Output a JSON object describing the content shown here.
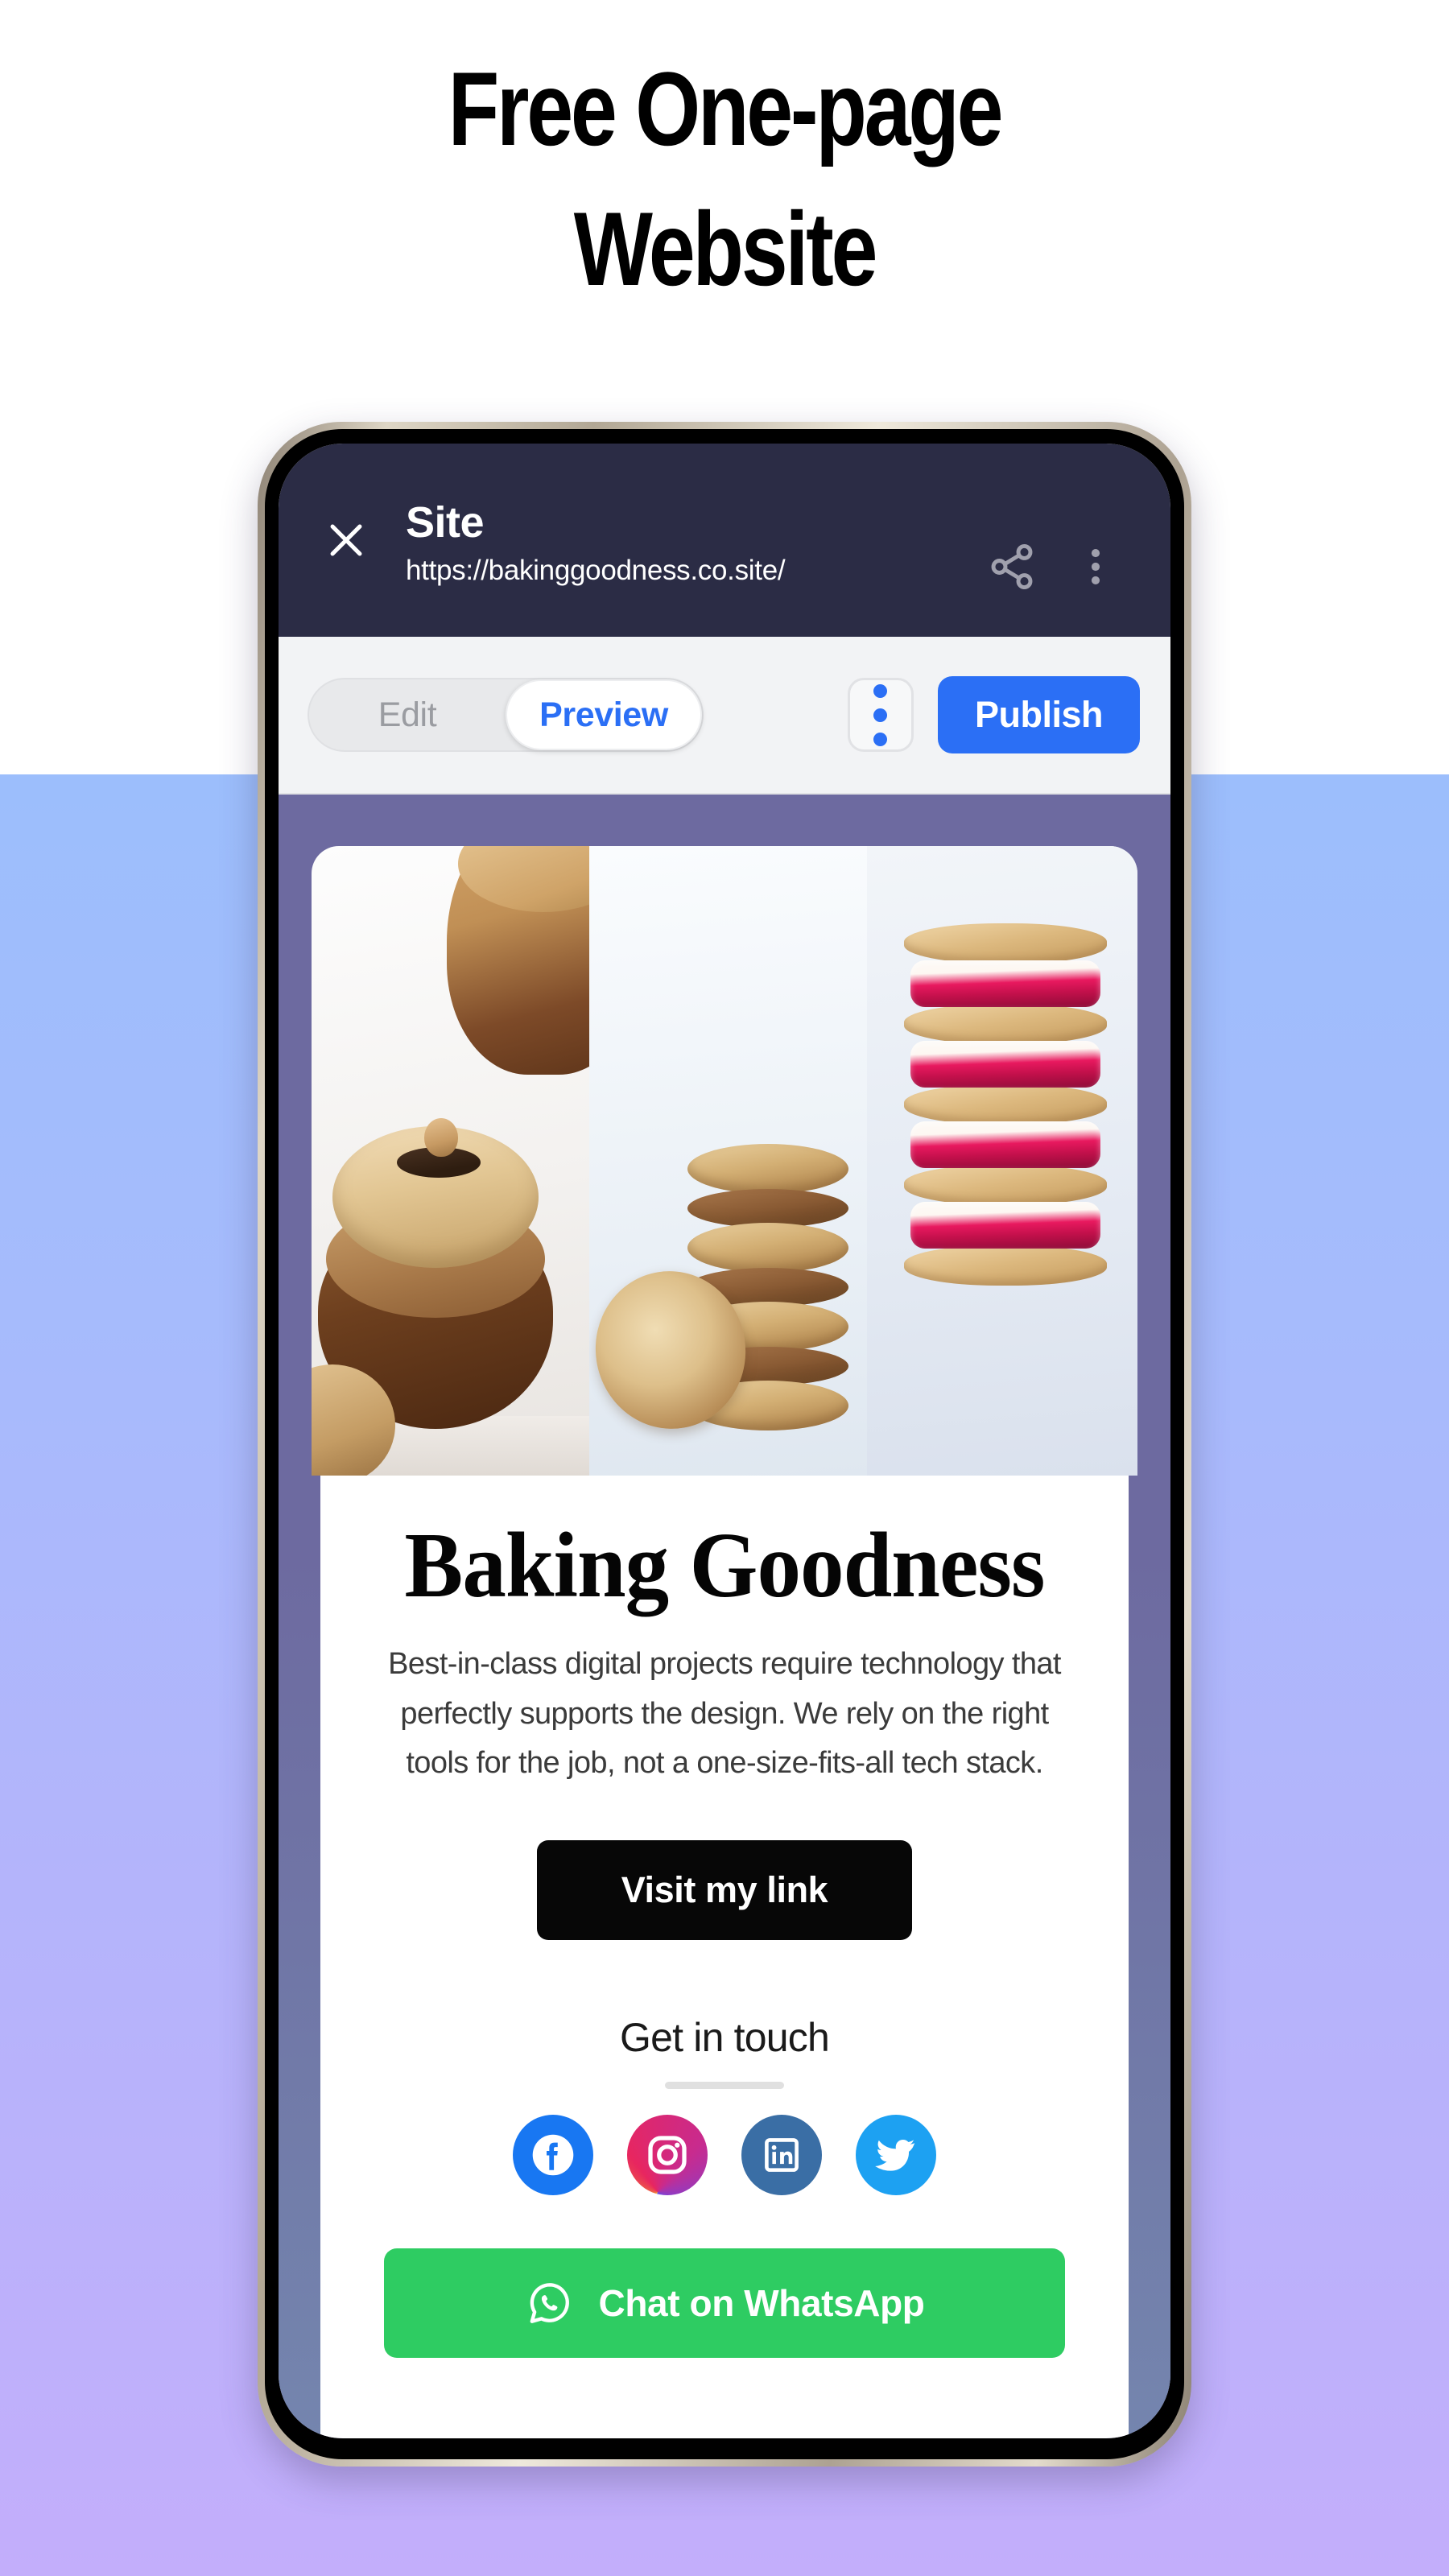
{
  "promo": {
    "headline": "Free One-page\nWebsite"
  },
  "colors": {
    "background_top": "#9CBEFC",
    "background_bottom": "#C3AEFB",
    "app_header": "#2B2C45",
    "accent_blue": "#2B6FF5",
    "site_frame_purple": "#6D6AA0",
    "cta_black": "#070707",
    "whatsapp_green": "#2ECC62",
    "facebook": "#1877F2",
    "linkedin": "#3A6EA5",
    "twitter": "#1DA1F2"
  },
  "app_header": {
    "close_icon": "close-icon",
    "title": "Site",
    "url": "https://bakinggoodness.co.site/",
    "share_icon": "share-icon",
    "more_icon": "more-vertical-icon"
  },
  "toolbar": {
    "segmented": [
      {
        "label": "Edit",
        "active": false
      },
      {
        "label": "Preview",
        "active": true
      }
    ],
    "kebab_icon": "more-vertical-icon",
    "publish_label": "Publish"
  },
  "site": {
    "collage": [
      {
        "name": "hazelnut-chocolate-pastry"
      },
      {
        "name": "almond-cookie-stack"
      },
      {
        "name": "raspberry-cream-sandwich-cookies"
      }
    ],
    "brand": "Baking Goodness",
    "blurb": "Best-in-class digital projects require technology that perfectly supports the design. We rely on the right tools for the job, not a one-size-fits-all tech stack.",
    "cta_label": "Visit my link",
    "contact_heading": "Get in touch",
    "socials": [
      {
        "name": "facebook-icon",
        "label": "Facebook"
      },
      {
        "name": "instagram-icon",
        "label": "Instagram"
      },
      {
        "name": "linkedin-icon",
        "label": "LinkedIn"
      },
      {
        "name": "twitter-icon",
        "label": "Twitter"
      }
    ],
    "whatsapp_label": "Chat on WhatsApp",
    "whatsapp_icon": "whatsapp-icon"
  }
}
